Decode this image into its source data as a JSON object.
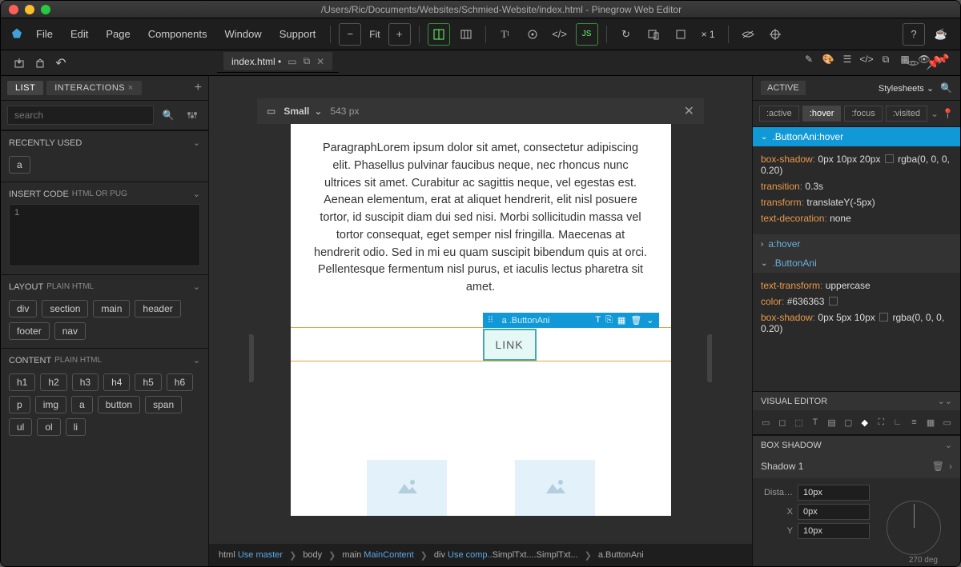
{
  "title_path": "/Users/Ric/Documents/Websites/Schmied-Website/index.html - Pinegrow Web Editor",
  "menubar": {
    "file": "File",
    "edit": "Edit",
    "page": "Page",
    "components": "Components",
    "window": "Window",
    "support": "Support",
    "fit": "Fit",
    "x1": "× 1"
  },
  "doc_tab": {
    "name": "index.html •"
  },
  "viewport": {
    "size_label": "Small",
    "width": "543 px"
  },
  "left": {
    "tab_list": "LIST",
    "tab_interactions": "INTERACTIONS",
    "search_placeholder": "search",
    "recently_used": "RECENTLY USED",
    "recently_items": [
      "a"
    ],
    "insert_code_label": "INSERT CODE",
    "insert_code_sub": "HTML or PUG",
    "code_line": "1",
    "layout_label": "LAYOUT",
    "layout_sub": "Plain HTML",
    "layout_items": [
      "div",
      "section",
      "main",
      "header",
      "footer",
      "nav"
    ],
    "content_label": "CONTENT",
    "content_sub": "Plain HTML",
    "content_items": [
      "h1",
      "h2",
      "h3",
      "h4",
      "h5",
      "h6",
      "p",
      "img",
      "a",
      "button",
      "span",
      "ul",
      "ol",
      "li"
    ]
  },
  "page": {
    "paragraph": "ParagraphLorem ipsum dolor sit amet, consectetur adipiscing elit. Phasellus pulvinar faucibus neque, nec rhoncus nunc ultrices sit amet. Curabitur ac sagittis neque, vel egestas est. Aenean elementum, erat at aliquet hendrerit, elit nisl posuere tortor, id suscipit diam dui sed nisi. Morbi sollicitudin massa vel tortor consequat, eget semper nisl fringilla. Maecenas at hendrerit odio. Sed in mi eu quam suscipit bibendum quis at orci. Pellentesque fermentum nisl purus, et iaculis lectus pharetra sit amet.",
    "sel_label": "a .ButtonAni",
    "link_text": "LINK"
  },
  "breadcrumb": {
    "b1a": "html",
    "b1b": "Use master",
    "b2": "body",
    "b3a": "main",
    "b3b": "MainContent",
    "b4a": "div",
    "b4b": "Use comp.",
    "b4c": ".SimplTxt...",
    "b4d": ".SimplTxt...",
    "b5": "a",
    "b5b": ".ButtonAni"
  },
  "right": {
    "active": "ACTIVE",
    "stylesheets": "Stylesheets",
    "pseudo": {
      "active": ":active",
      "hover": ":hover",
      "focus": ":focus",
      "visited": ":visited"
    },
    "rule1": {
      "selector": ".ButtonAni:hover",
      "props": [
        {
          "name": "box-shadow",
          "val": "0px 10px 20px",
          "extra": "rgba(0, 0, 0, 0.20)",
          "swatch": true
        },
        {
          "name": "transition",
          "val": "0.3s"
        },
        {
          "name": "transform",
          "val": "translateY(-5px)"
        },
        {
          "name": "text-decoration",
          "val": "none"
        }
      ]
    },
    "rule2": {
      "selector": "a:hover"
    },
    "rule3": {
      "selector": ".ButtonAni",
      "props": [
        {
          "name": "text-transform",
          "val": "uppercase"
        },
        {
          "name": "color",
          "val": "#636363",
          "swatch": true
        },
        {
          "name": "box-shadow",
          "val": "0px 5px 10px",
          "extra": "rgba(0, 0, 0, 0.20)",
          "swatch": true
        }
      ]
    },
    "visual_editor": "VISUAL EDITOR",
    "box_shadow": "BOX SHADOW",
    "shadow1": "Shadow 1",
    "dista_label": "Dista…",
    "dista_val": "10px",
    "x_label": "X",
    "x_val": "0px",
    "y_label": "Y",
    "y_val": "10px",
    "angle": "270 deg"
  }
}
